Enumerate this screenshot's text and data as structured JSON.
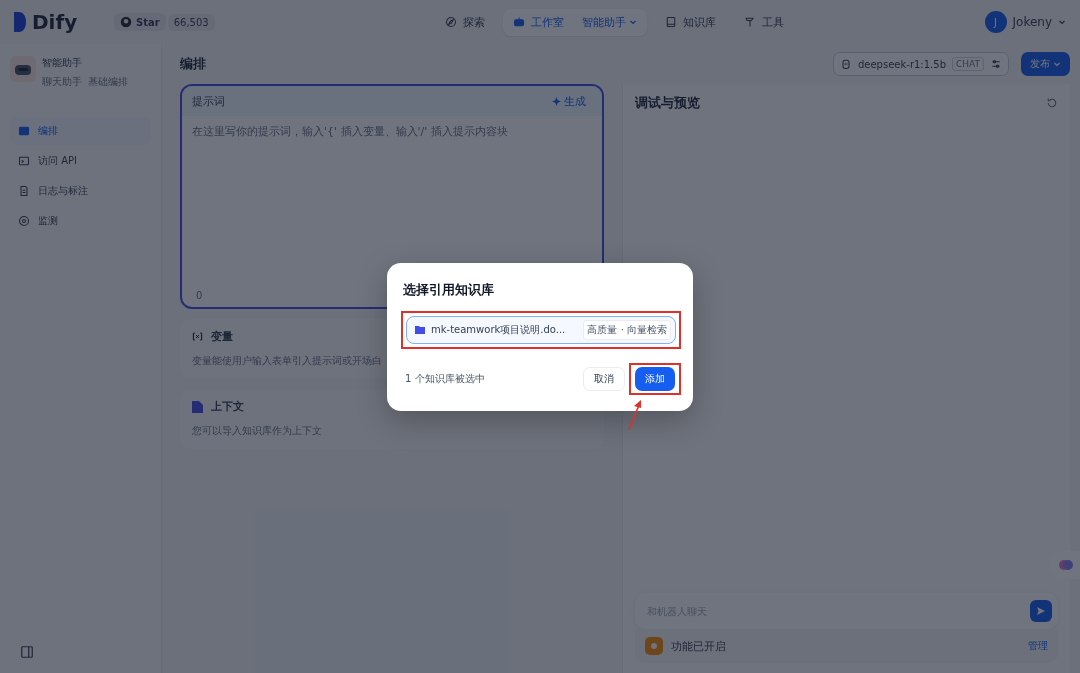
{
  "nav": {
    "logo": "Dify",
    "github": {
      "label": "Star",
      "count": "66,503"
    },
    "tabs": [
      {
        "kind": "explore",
        "label": "探索",
        "selected": false
      },
      {
        "kind": "studio",
        "label": "工作室",
        "selected": true,
        "app": "智能助手"
      },
      {
        "kind": "knowledge",
        "label": "知识库",
        "selected": false
      },
      {
        "kind": "tools",
        "label": "工具",
        "selected": false
      }
    ],
    "user": {
      "initial": "J",
      "name": "Jokeny"
    }
  },
  "app": {
    "name": "智能助手",
    "tags": [
      "聊天助手",
      "基础编排"
    ]
  },
  "sidebar": {
    "items": [
      {
        "kind": "orchestrate",
        "label": "编排",
        "selected": true
      },
      {
        "kind": "api",
        "label": "访问 API",
        "selected": false
      },
      {
        "kind": "logs",
        "label": "日志与标注",
        "selected": false
      },
      {
        "kind": "monitor",
        "label": "监测",
        "selected": false
      }
    ]
  },
  "page_title": "编排",
  "model": {
    "name": "deepseek-r1:1.5b",
    "badge": "CHAT"
  },
  "publish": "发布",
  "prompt": {
    "title": "提示词",
    "generate": "生成",
    "placeholder": "在这里写你的提示词，输入'{' 插入变量、输入'/' 插入提示内容块",
    "count": "0"
  },
  "variables": {
    "title": "变量",
    "description": "变量能使用户输入表单引入提示词或开场白"
  },
  "context": {
    "title": "上下文",
    "description": "您可以导入知识库作为上下文"
  },
  "debug": {
    "title": "调试与预览",
    "chat_placeholder": "和机器人聊天",
    "feature": "功能已开启",
    "manage": "管理"
  },
  "dialog": {
    "title": "选择引用知识库",
    "items": [
      {
        "name": "mk-teamwork项目说明.do...",
        "tag": "高质量 · 向量检索",
        "selected": true
      }
    ],
    "summary": "1 个知识库被选中",
    "cancel": "取消",
    "confirm": "添加"
  }
}
